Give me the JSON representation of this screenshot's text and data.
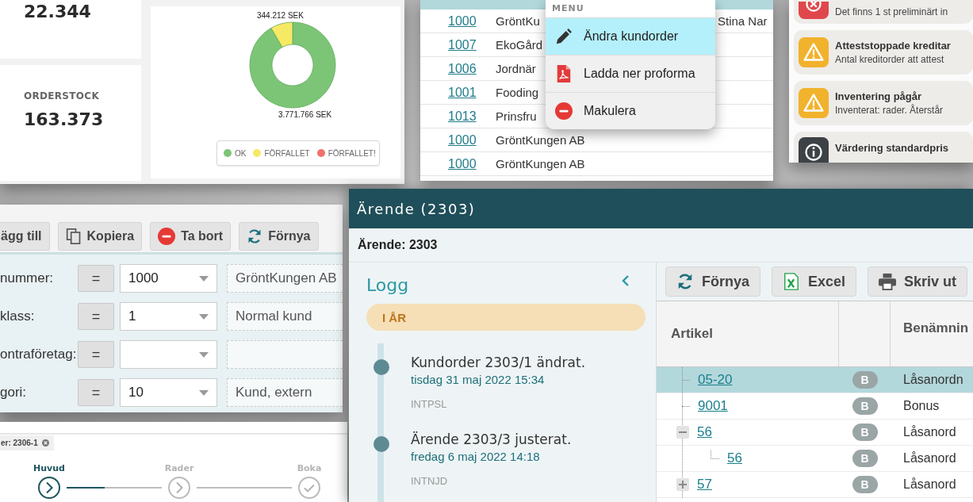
{
  "dashboard": {
    "kpis": [
      {
        "value": "22.344"
      },
      {
        "label": "ORDERSTOCK",
        "value": "163.373"
      }
    ],
    "chart_data": {
      "type": "donut",
      "categories": [
        "OK",
        "FÖRFALLET",
        "FÖRFALLET!"
      ],
      "series": [
        {
          "values": [
            91.64,
            8.36,
            0
          ]
        }
      ],
      "colors": [
        "#7cc576",
        "#f6e964",
        "#f2716b"
      ],
      "value_labels": [
        "3.771.766 SEK",
        "344.212 SEK",
        null
      ]
    }
  },
  "order_table": {
    "rows": [
      {
        "number": "1000",
        "name": "GröntKu",
        "contact": "Stina Nar"
      },
      {
        "number": "1007",
        "name": "EkoGård"
      },
      {
        "number": "1006",
        "name": "Jordnär"
      },
      {
        "number": "1001",
        "name": "Fooding"
      },
      {
        "number": "1013",
        "name": "Prinsfru"
      },
      {
        "number": "1000",
        "name": "GröntKungen AB"
      },
      {
        "number": "1000",
        "name": "GröntKungen AB"
      }
    ]
  },
  "context_menu": {
    "title": "MENU",
    "items": [
      {
        "kind": "edit",
        "label": "Ändra kundorder",
        "selected": true
      },
      {
        "kind": "pdf",
        "label": "Ladda ner proforma",
        "selected": false
      },
      {
        "kind": "cancel",
        "label": "Makulera",
        "selected": false
      }
    ]
  },
  "notifications": [
    {
      "kind": "error",
      "text": "Det finns 1 st preliminärt in"
    },
    {
      "kind": "warning",
      "title": "Atteststoppade kreditar",
      "text": "Antal kreditorder att attest"
    },
    {
      "kind": "warning",
      "title": "Inventering pågår",
      "text": "Inventerat: rader. Återstår"
    },
    {
      "kind": "info",
      "title": "Värdering standardpris"
    }
  ],
  "filter_form": {
    "toolbar": [
      {
        "kind": "add",
        "label": "ägg till"
      },
      {
        "kind": "copy",
        "label": "Kopiera"
      },
      {
        "kind": "delete",
        "label": "Ta bort"
      },
      {
        "kind": "refresh",
        "label": "Förnya"
      }
    ],
    "rows": [
      {
        "label": "nummer:",
        "operator": "=",
        "value": "1000",
        "description": "GröntKungen AB"
      },
      {
        "label": "klass:",
        "operator": "=",
        "value": "1",
        "description": "Normal kund"
      },
      {
        "label": "ontraföretag:",
        "operator": "="
      },
      {
        "label": "gori:",
        "operator": "=",
        "value": "10",
        "description": "Kund, extern"
      }
    ]
  },
  "wizard": {
    "tab": "er: 2306-1",
    "steps": [
      {
        "kind": "step",
        "label": "Huvud",
        "selected": true
      },
      {
        "kind": "step",
        "label": "Rader",
        "selected": false
      },
      {
        "kind": "finish",
        "label": "Boka",
        "selected": false
      }
    ]
  },
  "case_window": {
    "title": "Ärende (2303)",
    "heading": "Ärende: 2303",
    "log": {
      "title": "Logg",
      "group": "I ÅR",
      "entries": [
        {
          "title": "Kundorder 2303/1 ändrat.",
          "date": "tisdag 31 maj 2022 15:34",
          "user": "INTPSL"
        },
        {
          "title": "Ärende 2303/3 justerat.",
          "date": "fredag 6 maj 2022 14:18",
          "user": "INTNJD"
        }
      ]
    },
    "toolbar": [
      {
        "kind": "refresh",
        "label": "Förnya"
      },
      {
        "kind": "excel",
        "label": "Excel"
      },
      {
        "kind": "print",
        "label": "Skriv ut"
      }
    ],
    "table": {
      "columns": [
        "Artikel",
        "Benämnin"
      ],
      "rows": [
        {
          "article": "05-20",
          "badge": "B",
          "name": "Låsanordn",
          "selected": true
        },
        {
          "article": "9001",
          "badge": "B",
          "name": "Bonus",
          "selected": false
        },
        {
          "article": "56",
          "badge": "B",
          "name": "Låsanord",
          "selected": false,
          "expanded": true,
          "children": [
            {
              "article": "56",
              "badge": "B",
              "name": "Låsanord",
              "selected": false
            }
          ]
        },
        {
          "article": "57",
          "badge": "B",
          "name": "Låsanord",
          "selected": false,
          "expanded": false
        }
      ]
    }
  }
}
